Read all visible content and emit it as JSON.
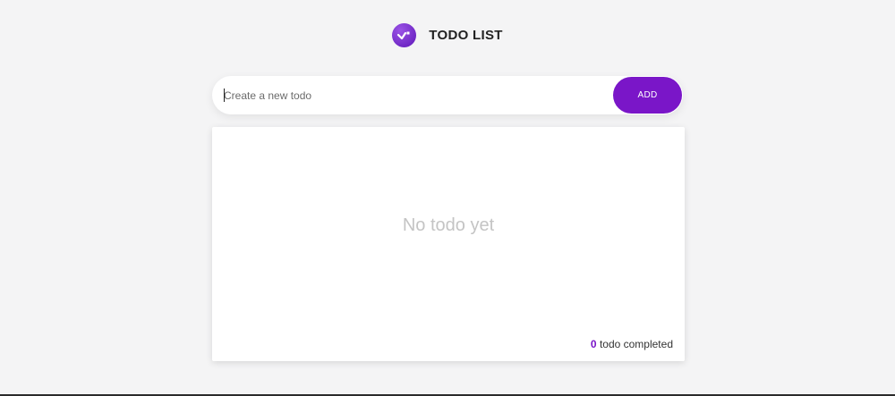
{
  "app": {
    "title": "TODO LIST",
    "logo_icon": "todo-check-icon",
    "accent": "#7a16c8"
  },
  "new_todo": {
    "placeholder": "Create a new todo",
    "value": "",
    "add_label": "ADD"
  },
  "todos": [],
  "empty_message": "No todo yet",
  "footer": {
    "completed_count": "0",
    "completed_label": "todo completed"
  }
}
